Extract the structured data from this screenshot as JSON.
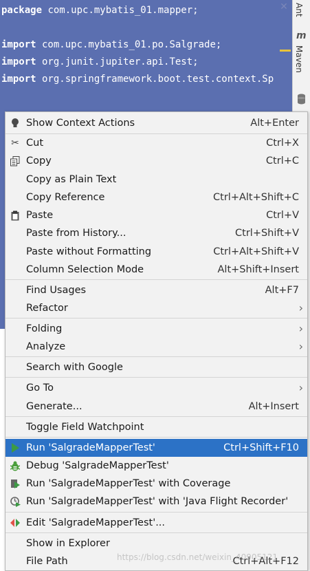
{
  "editor": {
    "lines": [
      {
        "kw": "package",
        "rest": " com.upc.mybatis_01.mapper;"
      },
      {
        "kw": "",
        "rest": ""
      },
      {
        "kw": "import",
        "rest": " com.upc.mybatis_01.po.Salgrade;"
      },
      {
        "kw": "import",
        "rest": " org.junit.jupiter.api.Test;"
      },
      {
        "kw": "import",
        "rest": " org.springframework.boot.test.context.Sp"
      }
    ],
    "close_glyph": "✕"
  },
  "right_strip": {
    "ant_label": "Ant",
    "maven_icon": "m",
    "maven_label": "Maven",
    "database_icon": "database-icon"
  },
  "menu": {
    "items": [
      {
        "label": "Show Context Actions",
        "shortcut": "Alt+Enter",
        "icon": "lightbulb-icon",
        "glyph": "💡"
      },
      {
        "label": "Cut",
        "shortcut": "Ctrl+X",
        "icon": "scissors-icon",
        "glyph": "✂"
      },
      {
        "label": "Copy",
        "shortcut": "Ctrl+C",
        "icon": "copy-icon",
        "glyph": "⧉"
      },
      {
        "label": "Copy as Plain Text",
        "shortcut": ""
      },
      {
        "label": "Copy Reference",
        "shortcut": "Ctrl+Alt+Shift+C"
      },
      {
        "label": "Paste",
        "shortcut": "Ctrl+V",
        "icon": "clipboard-icon",
        "glyph": "📋"
      },
      {
        "label": "Paste from History...",
        "shortcut": "Ctrl+Shift+V"
      },
      {
        "label": "Paste without Formatting",
        "shortcut": "Ctrl+Alt+Shift+V"
      },
      {
        "label": "Column Selection Mode",
        "shortcut": "Alt+Shift+Insert"
      },
      {
        "label": "Find Usages",
        "shortcut": "Alt+F7"
      },
      {
        "label": "Refactor",
        "submenu": true
      },
      {
        "label": "Folding",
        "submenu": true
      },
      {
        "label": "Analyze",
        "submenu": true
      },
      {
        "label": "Search with Google",
        "shortcut": ""
      },
      {
        "label": "Go To",
        "submenu": true
      },
      {
        "label": "Generate...",
        "shortcut": "Alt+Insert"
      },
      {
        "label": "Toggle Field Watchpoint",
        "shortcut": ""
      },
      {
        "label": "Run 'SalgradeMapperTest'",
        "shortcut": "Ctrl+Shift+F10",
        "icon": "run-icon",
        "glyph": "▶",
        "active": true
      },
      {
        "label": "Debug 'SalgradeMapperTest'",
        "icon": "debug-icon",
        "glyph": "🐞"
      },
      {
        "label": "Run 'SalgradeMapperTest' with Coverage",
        "icon": "coverage-icon",
        "glyph": "▶"
      },
      {
        "label": "Run 'SalgradeMapperTest' with 'Java Flight Recorder'",
        "icon": "profiler-icon",
        "glyph": "◔"
      },
      {
        "label": "Edit 'SalgradeMapperTest'...",
        "icon": "edit-config-icon",
        "glyph": "◆"
      },
      {
        "label": "Show in Explorer",
        "shortcut": ""
      },
      {
        "label": "File Path",
        "shortcut": "Ctrl+Alt+F12"
      }
    ],
    "submenu_arrow": "›"
  },
  "watermark": "https://blog.csdn.net/weixin_40905121",
  "colors": {
    "selection": "#5b6fb0",
    "highlight": "#2c72c6",
    "run_green": "#3d9a44",
    "debug_green": "#4a9e3b"
  }
}
